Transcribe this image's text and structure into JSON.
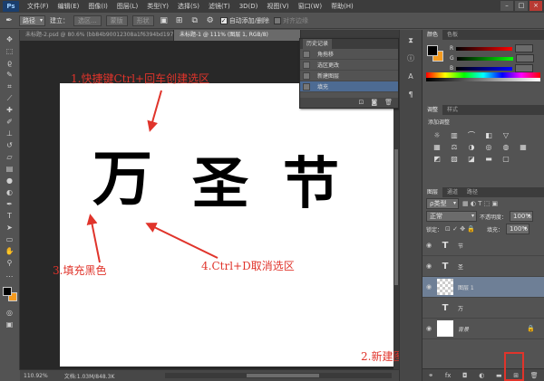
{
  "menubar": {
    "logo": "Ps",
    "items": [
      "文件(F)",
      "编辑(E)",
      "图像(I)",
      "图层(L)",
      "类型(Y)",
      "选择(S)",
      "滤镜(T)",
      "3D(D)",
      "视图(V)",
      "窗口(W)",
      "帮助(H)"
    ]
  },
  "options": {
    "tool_preset": "路径",
    "make_label": "建立：",
    "selection_btn": "选区...",
    "mask_btn": "蒙版",
    "shape_btn": "形状",
    "auto_add_delete": "自动添加/删除",
    "align_edges": "对齐边缘"
  },
  "tabs": [
    {
      "label": "未标题-2.psd @ 80.6% (bb84b90012308a1f6394bd197d52b, RGB/8)",
      "active": false
    },
    {
      "label": "未标题-1 @ 111% (图层 1, RGB/8)",
      "active": true
    }
  ],
  "canvas": {
    "chars": [
      "万",
      "圣",
      "节"
    ]
  },
  "annotations": {
    "step1": "1.快捷键Ctrl+回车创建选区",
    "step2": "2.新建图层",
    "step3": "3.填充黑色",
    "step4": "4.Ctrl+D取消选区",
    "color": "#e0342b"
  },
  "history": {
    "title": "历史记录",
    "items": [
      {
        "label": "角拖移",
        "selected": false
      },
      {
        "label": "选区更改",
        "selected": false
      },
      {
        "label": "新建图层",
        "selected": false
      },
      {
        "label": "填充",
        "selected": true
      }
    ]
  },
  "status": {
    "zoom": "110.92%",
    "doc": "文档:1.03M/848.3K"
  },
  "color_panel": {
    "tabs": [
      "颜色",
      "色板"
    ],
    "channels": [
      "R",
      "G",
      "B"
    ],
    "foreground": "#000000",
    "background": "#f39a1f"
  },
  "adjust_panel": {
    "tabs": [
      "调整",
      "样式"
    ],
    "title": "添加调整"
  },
  "layers_panel": {
    "tabs": [
      "图层",
      "通道",
      "路径"
    ],
    "filter": "ρ类型",
    "blend_mode": "正常",
    "opacity_label": "不透明度：",
    "opacity_value": "100%",
    "lock_label": "锁定：",
    "fill_label": "填充：",
    "fill_value": "100%",
    "layers": [
      {
        "name": "节",
        "thumb": "T",
        "selected": false,
        "visible": true
      },
      {
        "name": "圣",
        "thumb": "T",
        "selected": false,
        "visible": true
      },
      {
        "name": "图层 1",
        "thumb": "",
        "selected": true,
        "visible": true
      },
      {
        "name": "万",
        "thumb": "T",
        "selected": false,
        "visible": false
      },
      {
        "name": "背景",
        "thumb": "",
        "selected": false,
        "visible": true
      }
    ]
  }
}
